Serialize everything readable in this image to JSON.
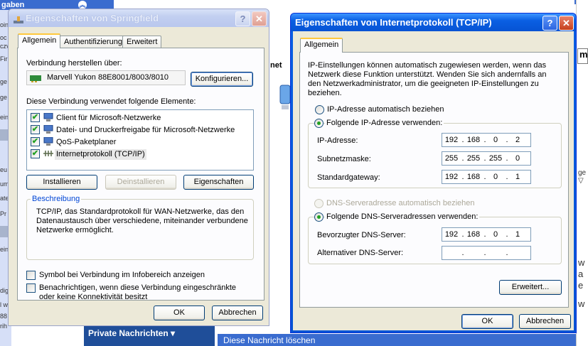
{
  "background": {
    "left_header": "gaben",
    "left_fragments": [
      "oin",
      "oc",
      "czv",
      "Fir",
      "ge",
      "ge",
      "ein",
      "eu",
      "um",
      "ate",
      "Pr",
      "ein",
      "dig",
      "l w",
      "88",
      "rih"
    ],
    "middle_text": "net",
    "bottom_bar": "Private Nachrichten ▾",
    "bottom_bar2": "Diese Nachricht löschen",
    "right_box_text": "m",
    "right_fragments": [
      "ge ▽",
      "w",
      "a",
      "e",
      "w"
    ]
  },
  "dialog1": {
    "title": "Eigenschaften von Springfield",
    "tabs": [
      "Allgemein",
      "Authentifizierung",
      "Erweitert"
    ],
    "connect_label": "Verbindung herstellen über:",
    "adapter_name": "Marvell Yukon 88E8001/8003/8010",
    "configure_button": "Konfigurieren...",
    "components_label": "Diese Verbindung verwendet folgende Elemente:",
    "components": [
      {
        "label": "Client für Microsoft-Netzwerke",
        "checked": true,
        "icon": "network-client-icon"
      },
      {
        "label": "Datei- und Druckerfreigabe für Microsoft-Netzwerke",
        "checked": true,
        "icon": "network-share-icon"
      },
      {
        "label": "QoS-Paketplaner",
        "checked": true,
        "icon": "network-qos-icon"
      },
      {
        "label": "Internetprotokoll (TCP/IP)",
        "checked": true,
        "icon": "protocol-icon"
      }
    ],
    "install_button": "Installieren",
    "uninstall_button": "Deinstallieren",
    "properties_button": "Eigenschaften",
    "description_legend": "Beschreibung",
    "description_text": "TCP/IP, das Standardprotokoll für WAN-Netzwerke, das den Datenaustausch über verschiedene, miteinander verbundene Netzwerke ermöglicht.",
    "tray_icon_label": "Symbol bei Verbindung im Infobereich anzeigen",
    "notify_label": "Benachrichtigen, wenn diese Verbindung eingeschränkte oder keine Konnektivität besitzt",
    "ok_button": "OK",
    "cancel_button": "Abbrechen"
  },
  "dialog2": {
    "title": "Eigenschaften von Internetprotokoll (TCP/IP)",
    "tab": "Allgemein",
    "intro_text": "IP-Einstellungen können automatisch zugewiesen werden, wenn das Netzwerk diese Funktion unterstützt. Wenden Sie sich andernfalls an den Netzwerkadministrator, um die geeigneten IP-Einstellungen zu beziehen.",
    "auto_ip_label": "IP-Adresse automatisch beziehen",
    "manual_ip_label": "Folgende IP-Adresse verwenden:",
    "ip_label": "IP-Adresse:",
    "ip": [
      "192",
      "168",
      "0",
      "2"
    ],
    "subnet_label": "Subnetzmaske:",
    "subnet": [
      "255",
      "255",
      "255",
      "0"
    ],
    "gateway_label": "Standardgateway:",
    "gateway": [
      "192",
      "168",
      "0",
      "1"
    ],
    "auto_dns_label": "DNS-Serveradresse automatisch beziehen",
    "manual_dns_label": "Folgende DNS-Serveradressen verwenden:",
    "preferred_dns_label": "Bevorzugter DNS-Server:",
    "preferred_dns": [
      "192",
      "168",
      "0",
      "1"
    ],
    "alternate_dns_label": "Alternativer DNS-Server:",
    "alternate_dns": [
      "",
      "",
      "",
      ""
    ],
    "advanced_button": "Erweitert...",
    "ok_button": "OK",
    "cancel_button": "Abbrechen"
  }
}
